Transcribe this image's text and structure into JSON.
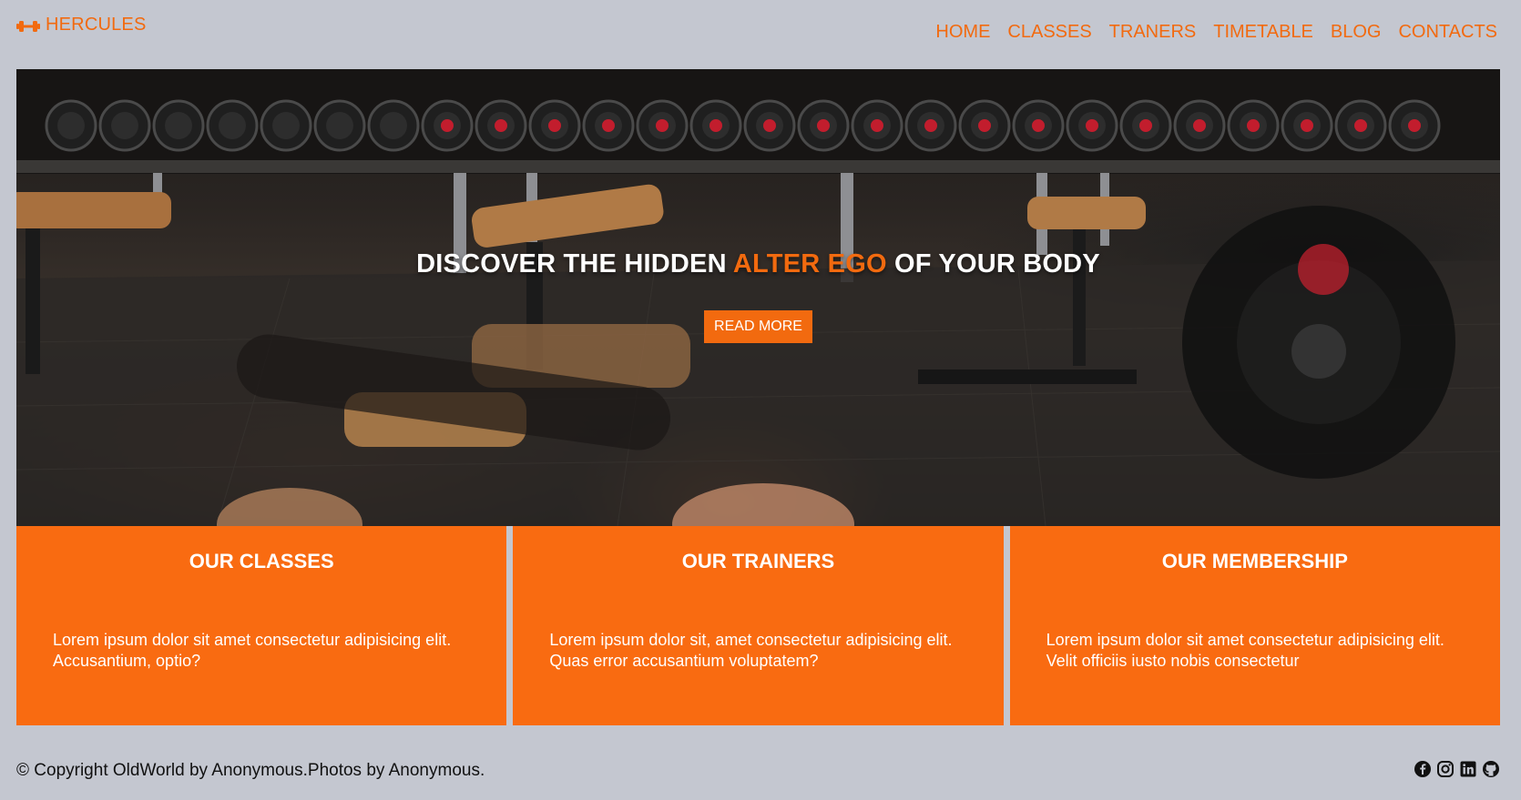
{
  "brand": {
    "name": "HERCULES",
    "icon": "dumbbell-icon"
  },
  "nav": {
    "items": [
      "HOME",
      "CLASSES",
      "TRANERS",
      "TIMETABLE",
      "BLOG",
      "CONTACTS"
    ]
  },
  "hero": {
    "title_part1": "DISCOVER THE HIDDEN ",
    "title_accent": "ALTER EGO",
    "title_part2": " OF YOUR BODY",
    "button_label": "READ MORE"
  },
  "cards": [
    {
      "title": "OUR CLASSES",
      "text": "Lorem ipsum dolor sit amet consectetur adipisicing elit. Accusantium, optio?"
    },
    {
      "title": "OUR TRAINERS",
      "text": "Lorem ipsum dolor sit, amet consectetur adipisicing elit. Quas error accusantium voluptatem?"
    },
    {
      "title": "OUR MEMBERSHIP",
      "text": "Lorem ipsum dolor sit amet consectetur adipisicing elit. Velit officiis iusto nobis consectetur"
    }
  ],
  "footer": {
    "copyright": "© Copyright OldWorld by Anonymous.Photos by Anonymous.",
    "social_icons": [
      "facebook-icon",
      "instagram-icon",
      "linkedin-icon",
      "github-icon"
    ]
  },
  "colors": {
    "accent": "#f26a0f",
    "card_bg": "#f96b11",
    "page_bg": "#c4c7d0"
  }
}
